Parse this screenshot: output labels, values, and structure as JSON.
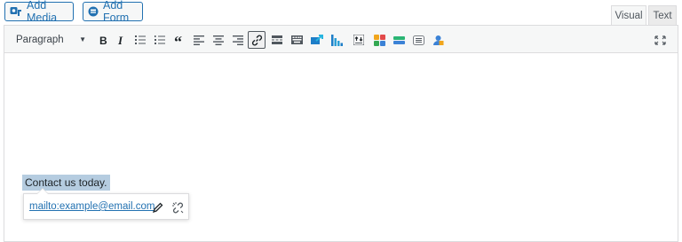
{
  "header": {
    "add_media_label": "Add Media",
    "add_form_label": "Add Form",
    "tabs": [
      {
        "label": "Visual",
        "active": true
      },
      {
        "label": "Text",
        "active": false
      }
    ]
  },
  "toolbar": {
    "format_select_value": "Paragraph",
    "buttons": [
      {
        "name": "bold-button",
        "icon": "bold-icon"
      },
      {
        "name": "italic-button",
        "icon": "italic-icon"
      },
      {
        "name": "bulleted-list-button",
        "icon": "bulleted-list-icon"
      },
      {
        "name": "numbered-list-button",
        "icon": "numbered-list-icon"
      },
      {
        "name": "blockquote-button",
        "icon": "quote-icon"
      },
      {
        "name": "align-left-button",
        "icon": "align-left-icon"
      },
      {
        "name": "align-center-button",
        "icon": "align-center-icon"
      },
      {
        "name": "align-right-button",
        "icon": "align-right-icon"
      },
      {
        "name": "insert-link-button",
        "icon": "link-icon",
        "active": true
      },
      {
        "name": "read-more-button",
        "icon": "read-more-icon"
      },
      {
        "name": "toolbar-toggle-button",
        "icon": "keyboard-icon"
      },
      {
        "name": "plugin-insert-button",
        "icon": "plugin-arrow-icon"
      },
      {
        "name": "chart-button",
        "icon": "bar-chart-icon"
      },
      {
        "name": "columns-button",
        "icon": "columns-icon"
      },
      {
        "name": "color-grid-button",
        "icon": "color-grid-icon"
      },
      {
        "name": "green-bar-button",
        "icon": "green-bar-icon"
      },
      {
        "name": "list-box-button",
        "icon": "list-box-icon"
      },
      {
        "name": "user-lock-button",
        "icon": "user-lock-icon"
      },
      {
        "name": "fullscreen-button",
        "icon": "fullscreen-icon"
      }
    ]
  },
  "content": {
    "selected_text": "Contact us today.",
    "link_popup": {
      "url": "mailto:example@email.com",
      "edit_icon": "pencil-icon",
      "unlink_icon": "unlink-icon"
    }
  },
  "colors": {
    "accent": "#2271b1",
    "selection": "#b5cce0",
    "toolbar_bg": "#f6f7f7",
    "border": "#dcdcde"
  }
}
